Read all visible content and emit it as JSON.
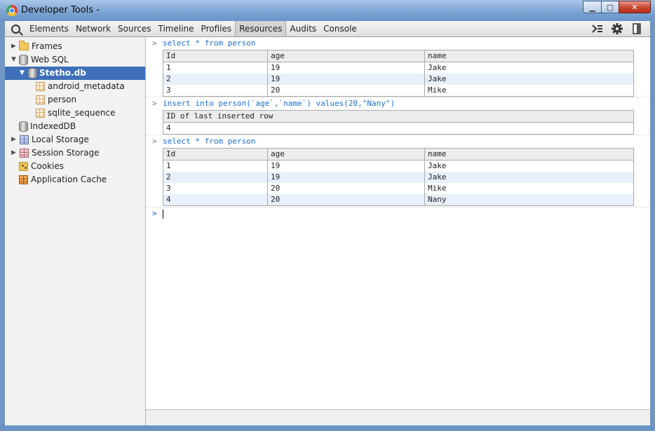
{
  "window": {
    "title": "Developer Tools -"
  },
  "toolbar": {
    "tabs": [
      "Elements",
      "Network",
      "Sources",
      "Timeline",
      "Profiles",
      "Resources",
      "Audits",
      "Console"
    ],
    "active_tab": "Resources"
  },
  "sidebar": {
    "items": [
      {
        "label": "Frames",
        "icon": "folder-icon"
      },
      {
        "label": "Web SQL",
        "icon": "database-icon"
      },
      {
        "label": "Stetho.db",
        "icon": "database-icon"
      },
      {
        "label": "android_metadata",
        "icon": "table-icon"
      },
      {
        "label": "person",
        "icon": "table-icon"
      },
      {
        "label": "sqlite_sequence",
        "icon": "table-icon"
      },
      {
        "label": "IndexedDB",
        "icon": "database-icon"
      },
      {
        "label": "Local Storage",
        "icon": "storage-icon"
      },
      {
        "label": "Session Storage",
        "icon": "storage-icon"
      },
      {
        "label": "Cookies",
        "icon": "cookie-icon"
      },
      {
        "label": "Application Cache",
        "icon": "cache-icon"
      }
    ]
  },
  "console": {
    "prompt": ">",
    "entries": [
      {
        "command": "select * from person",
        "columns": [
          "Id",
          "age",
          "name"
        ],
        "rows": [
          [
            "1",
            "19",
            "Jake"
          ],
          [
            "2",
            "19",
            "Jake"
          ],
          [
            "3",
            "20",
            "Mike"
          ]
        ]
      },
      {
        "command": "insert into person(`age`,`name`) values(20,\"Nany\")",
        "columns": [
          "ID of last inserted row"
        ],
        "rows": [
          [
            "4"
          ]
        ]
      },
      {
        "command": "select * from person",
        "columns": [
          "Id",
          "age",
          "name"
        ],
        "rows": [
          [
            "1",
            "19",
            "Jake"
          ],
          [
            "2",
            "19",
            "Jake"
          ],
          [
            "3",
            "20",
            "Mike"
          ],
          [
            "4",
            "20",
            "Nany"
          ]
        ]
      }
    ]
  },
  "colors": {
    "selection": "#3e6fb8",
    "command_text": "#1a6fd1",
    "row_alt": "#e7f0fb"
  }
}
